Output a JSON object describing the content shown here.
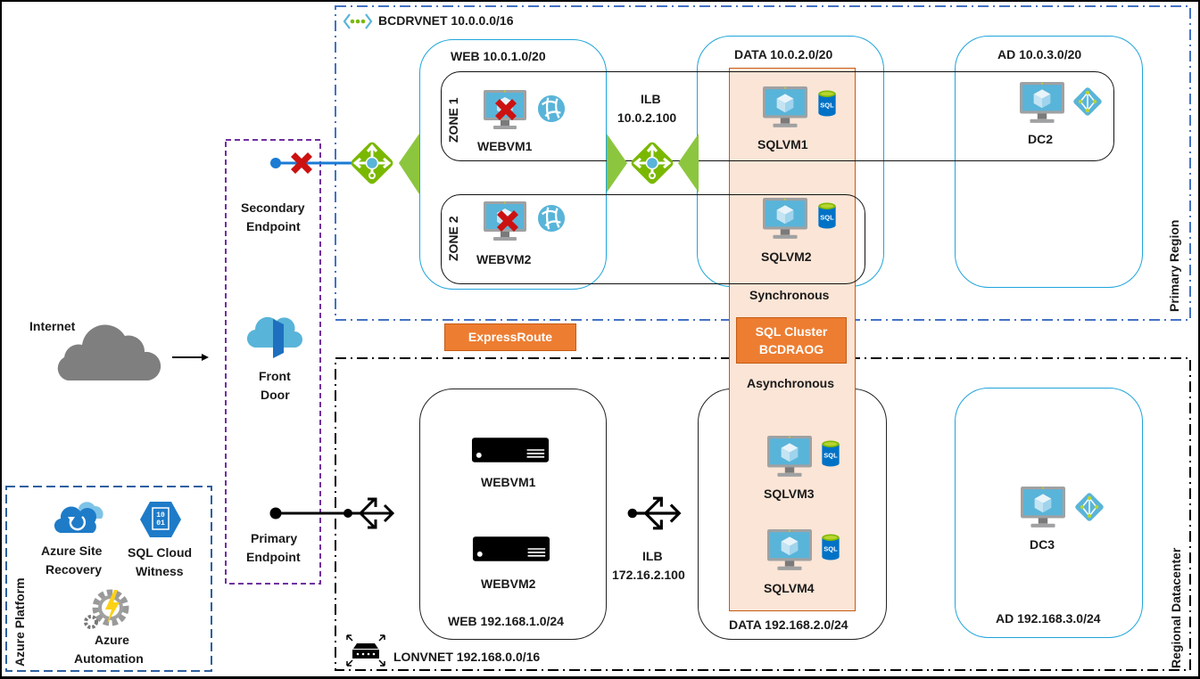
{
  "colors": {
    "primary_region_border": "#4472c4",
    "secondary_region_border": "#000000",
    "front_door_border": "#7030a0",
    "subnet_border": "#1fa4dc",
    "sql_band_fill": "#fbe5d6",
    "sql_band_border": "#c55a11",
    "orange_label": "#ed7d31",
    "failure_x": "#cc0000",
    "lb_green": "#7ab800",
    "azure_blue": "#59b4d9"
  },
  "internet": {
    "label": "Internet"
  },
  "front_door": {
    "label_line1": "Front",
    "label_line2": "Door",
    "secondary_endpoint_line1": "Secondary",
    "secondary_endpoint_line2": "Endpoint",
    "primary_endpoint_line1": "Primary",
    "primary_endpoint_line2": "Endpoint"
  },
  "azure_platform": {
    "title": "Azure Platform",
    "services": [
      {
        "line1": "Azure Site",
        "line2": "Recovery",
        "icon": "site-recovery-icon"
      },
      {
        "line1": "SQL Cloud",
        "line2": "Witness",
        "icon": "storage-blob-icon"
      },
      {
        "line1": "Azure",
        "line2": "Automation",
        "icon": "automation-icon"
      }
    ]
  },
  "primary_region": {
    "title": "Primary Region",
    "vnet": "BCDRVNET 10.0.0.0/16",
    "ilb_label": "ILB",
    "ilb_ip": "10.0.2.100",
    "subnets": {
      "web": "WEB 10.0.1.0/20",
      "data": "DATA 10.0.2.0/20",
      "ad": "AD 10.0.3.0/20"
    },
    "zones": [
      "ZONE 1",
      "ZONE 2"
    ],
    "vms": {
      "webvm1": "WEBVM1",
      "webvm2": "WEBVM2",
      "sqlvm1": "SQLVM1",
      "sqlvm2": "SQLVM2",
      "dc2": "DC2"
    }
  },
  "replication": {
    "synchronous": "Synchronous",
    "asynchronous": "Asynchronous",
    "cluster_line1": "SQL Cluster",
    "cluster_line2": "BCDRAOG",
    "expressroute": "ExpressRoute"
  },
  "secondary_region": {
    "title": "Regional Datacenter",
    "vnet": "LONVNET 192.168.0.0/16",
    "ilb_label": "ILB",
    "ilb_ip": "172.16.2.100",
    "subnets": {
      "web": "WEB 192.168.1.0/24",
      "data": "DATA 192.168.2.0/24",
      "ad": "AD 192.168.3.0/24"
    },
    "vms": {
      "webvm1": "WEBVM1",
      "webvm2": "WEBVM2",
      "sqlvm3": "SQLVM3",
      "sqlvm4": "SQLVM4",
      "dc3": "DC3"
    }
  }
}
